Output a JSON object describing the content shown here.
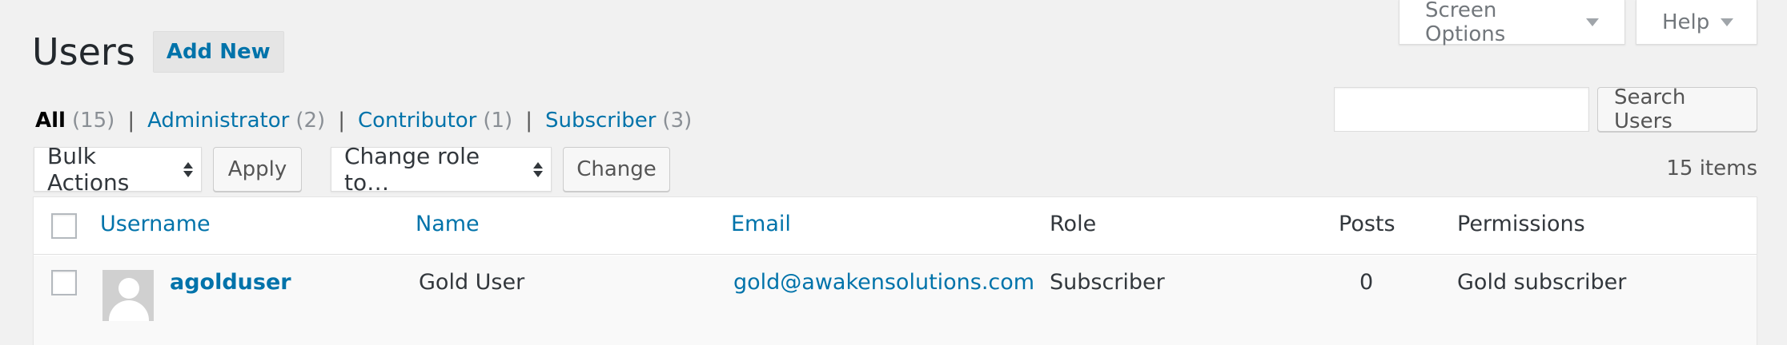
{
  "header": {
    "title": "Users",
    "add_new": "Add New"
  },
  "screen_meta": {
    "screen_options": "Screen Options",
    "help": "Help"
  },
  "filters": [
    {
      "label": "All",
      "count": "(15)"
    },
    {
      "label": "Administrator",
      "count": "(2)"
    },
    {
      "label": "Contributor",
      "count": "(1)"
    },
    {
      "label": "Subscriber",
      "count": "(3)"
    }
  ],
  "filter_separator": "|",
  "search": {
    "value": "",
    "button": "Search Users"
  },
  "tablenav": {
    "bulk_actions": "Bulk Actions",
    "apply": "Apply",
    "change_role": "Change role to…",
    "change": "Change",
    "items_count": "15 items"
  },
  "table": {
    "columns": [
      "Username",
      "Name",
      "Email",
      "Role",
      "Posts",
      "Permissions"
    ],
    "rows": [
      {
        "username": "agolduser",
        "name": "Gold User",
        "email": "gold@awakensolutions.com",
        "role": "Subscriber",
        "posts": "0",
        "permissions": "Gold subscriber"
      }
    ]
  },
  "icons": {
    "dropdown": "caret-down-icon",
    "select": "select-arrows-icon",
    "avatar": "default-avatar-icon"
  },
  "colors": {
    "link": "#0073aa",
    "background": "#f1f1f1"
  }
}
